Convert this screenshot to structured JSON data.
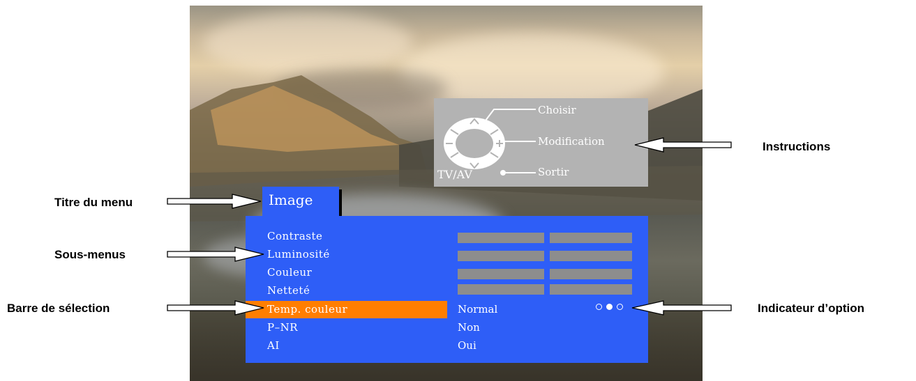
{
  "instructions": {
    "select": "Choisir",
    "modify": "Modification",
    "exit": "Sortir",
    "exit_key": "TV/AV",
    "icons": [
      "remote-dpad-icon",
      "up-arrow-icon",
      "down-arrow-icon",
      "minus-icon",
      "plus-icon",
      "button-dot-icon"
    ]
  },
  "menu": {
    "title": "Image",
    "items": [
      {
        "label": "Contraste",
        "value": ""
      },
      {
        "label": "Luminosité",
        "value": ""
      },
      {
        "label": "Couleur",
        "value": ""
      },
      {
        "label": "Netteté",
        "value": ""
      },
      {
        "label": "Temp. couleur",
        "value": "Normal"
      },
      {
        "label": "P–NR",
        "value": "Non"
      },
      {
        "label": "AI",
        "value": "Oui"
      }
    ],
    "selected_index": 4,
    "option_indicator": {
      "count": 3,
      "active": 2
    }
  },
  "callouts": {
    "menu_title": "Titre du menu",
    "submenus": "Sous-menus",
    "selection_bar": "Barre de sélection",
    "instructions": "Instructions",
    "option_indicator": "Indicateur d’option"
  },
  "colors": {
    "menu_blue": "#2e5ef7",
    "selection_orange": "#ff7e00",
    "instructions_gray": "#b3b3b3",
    "bar_gray": "#8d8d8d"
  }
}
